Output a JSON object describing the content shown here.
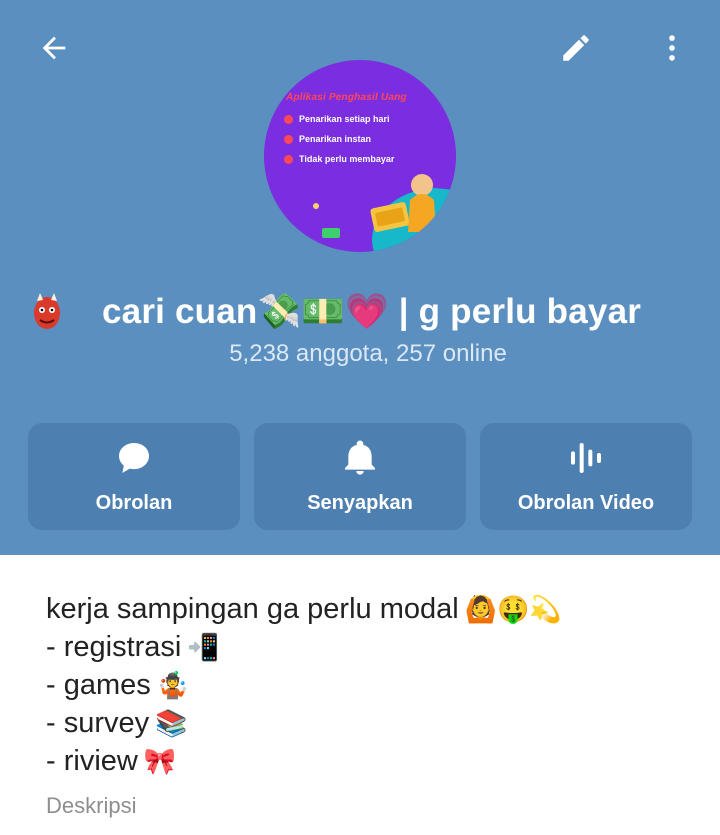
{
  "header": {
    "back_icon": "arrow-left-icon",
    "edit_icon": "pencil-icon",
    "more_icon": "more-vertical-icon",
    "avatar": {
      "title": "Aplikasi Penghasil Uang",
      "lines": [
        "Penarikan setiap hari",
        "Penarikan instan",
        "Tidak perlu membayar"
      ]
    },
    "title_emoji": "👺",
    "title": "cari cuan💸💵💗 | g perlu bayar",
    "subtitle": "5,238 anggota, 257 online"
  },
  "actions": [
    {
      "label": "Obrolan",
      "icon": "chat-bubble-icon"
    },
    {
      "label": "Senyapkan",
      "icon": "bell-icon"
    },
    {
      "label": "Obrolan Video",
      "icon": "voice-wave-icon"
    }
  ],
  "description": {
    "lines": [
      {
        "text": "kerja sampingan ga perlu modal",
        "emoji": "🙆🤑💫"
      },
      {
        "text": "- registrasi",
        "emoji": "📲"
      },
      {
        "text": "- games",
        "emoji": "🤹"
      },
      {
        "text": "- survey",
        "emoji": "📚"
      },
      {
        "text": "- riview",
        "emoji": "🎀"
      }
    ],
    "label": "Deskripsi"
  },
  "colors": {
    "header_bg": "#5b8fbf",
    "button_bg": "#4d7fb0",
    "avatar_bg": "#7b2ee0",
    "text_main": "#222222",
    "text_muted": "#8e8e8e"
  }
}
